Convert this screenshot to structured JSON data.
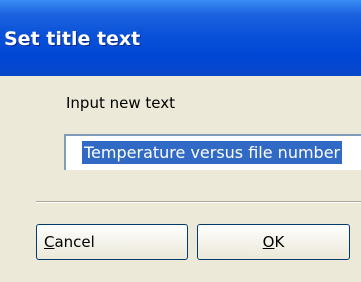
{
  "dialog": {
    "title": "Set title text",
    "prompt": "Input new text",
    "input_value": "Temperature versus file number",
    "cancel": {
      "mnemonic": "C",
      "rest": "ancel"
    },
    "ok": {
      "mnemonic": "O",
      "rest": "K"
    }
  }
}
